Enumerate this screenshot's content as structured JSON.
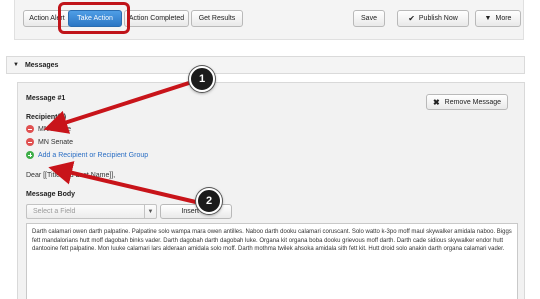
{
  "toolbar": {
    "action_alert": "Action Alert",
    "take_action": "Take Action",
    "action_completed": "Action Completed",
    "get_results": "Get Results",
    "save": "Save",
    "publish_now": "Publish Now",
    "more": "More"
  },
  "messages": {
    "section_title": "Messages",
    "message_title": "Message #1",
    "remove_label": "Remove Message",
    "recipients_label": "Recipient(s)",
    "recipients": [
      "MN House",
      "MN Senate"
    ],
    "add_recipient": "Add a Recipient or Recipient Group",
    "salutation": "Dear [[Title and Last Name]],",
    "body_label": "Message Body",
    "select_placeholder": "Select a Field",
    "insert_label": "Insert Mo",
    "body_text": "Darth calamari owen darth palpatine. Palpatine solo wampa mara owen antilles. Naboo darth dooku calamari coruscant. Solo watto k-3po moff maul skywalker amidala naboo. Biggs fett mandalorians hutt moff dagobah binks vader. Darth dagobah darth dagobah luke. Organa kit organa boba dooku grievous moff darth. Darth cade sidious skywalker endor hutt dantooine fett palpatine. Mon luuke calamari lars alderaan amidala solo moff. Darth mothma twilek ahsoka amidala sith fett kit. Hutt droid solo anakin darth organa calamari vader."
  },
  "annotations": {
    "marker_1": "1",
    "marker_2": "2"
  },
  "colors": {
    "highlight": "#c0141a",
    "primary": "#2b76c4",
    "link": "#2a6ec4"
  }
}
